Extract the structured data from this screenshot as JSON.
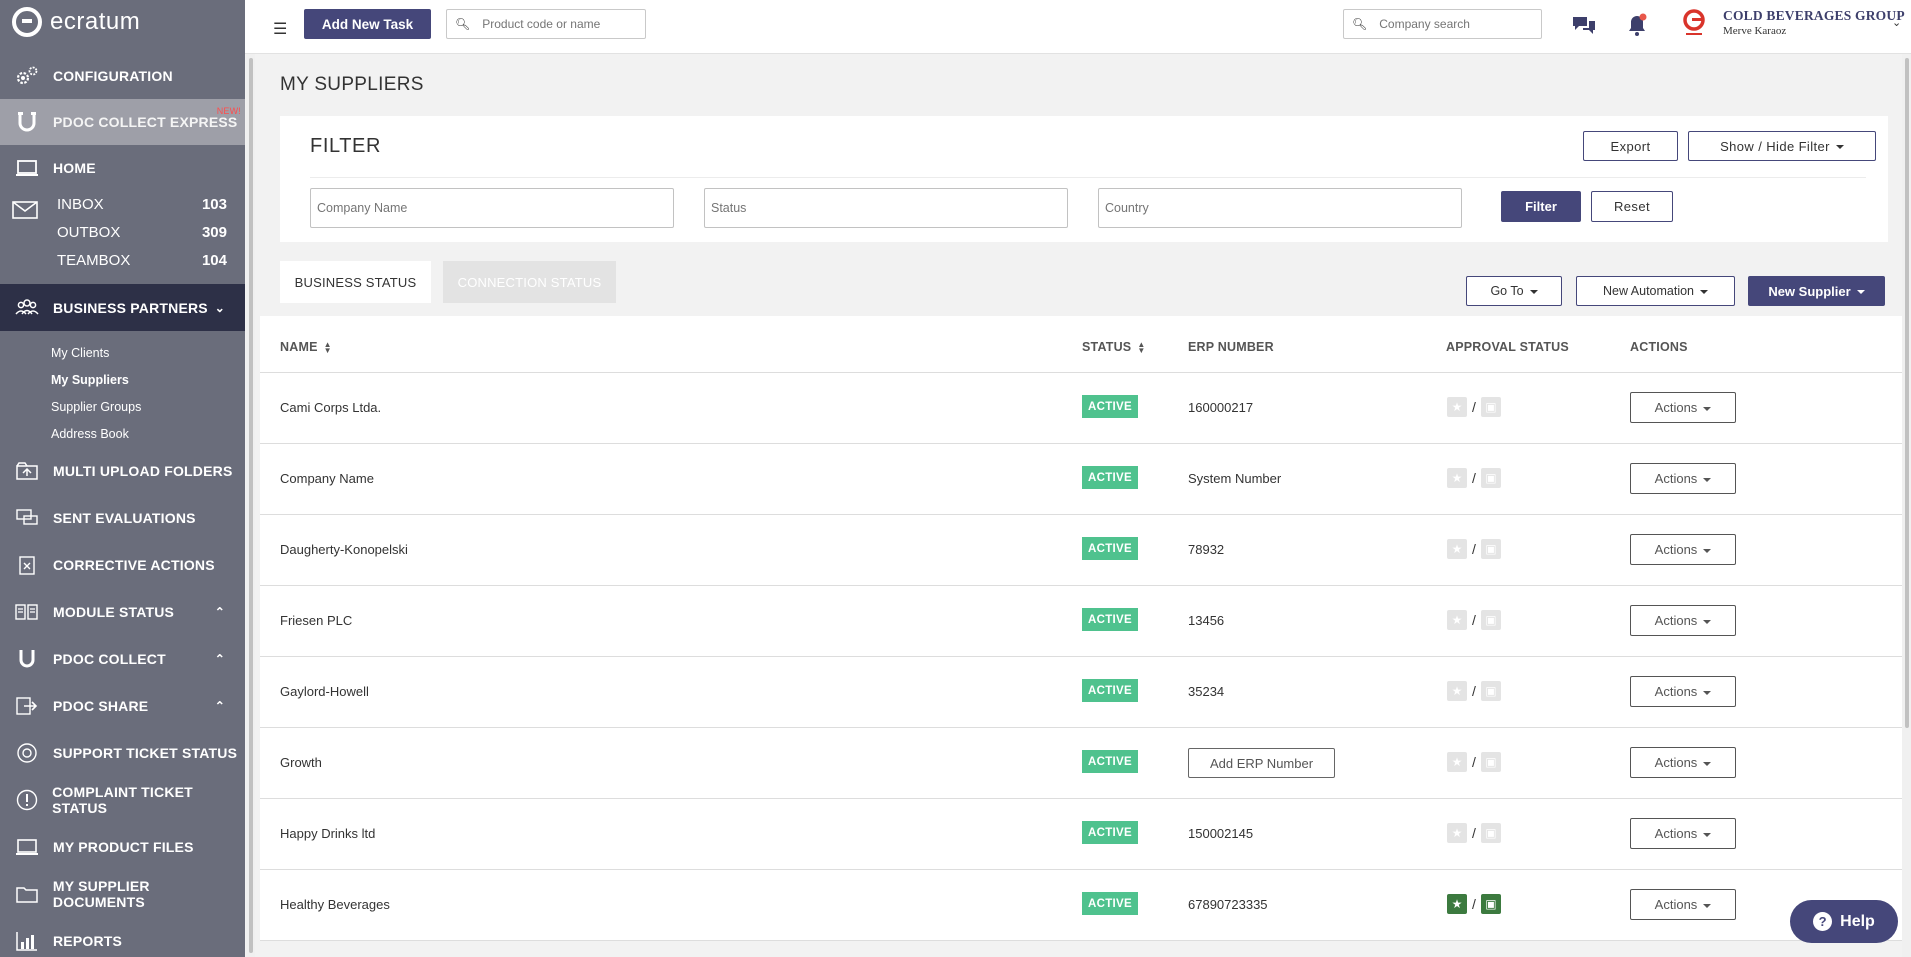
{
  "sidebar": {
    "logo_text": "ecratum",
    "items": [
      {
        "label": "CONFIGURATION",
        "icon": "gears-icon"
      },
      {
        "label": "PDOC COLLECT EXPRESS",
        "icon": "magnet-icon",
        "badge": "NEW!"
      },
      {
        "label": "HOME",
        "icon": "laptop-icon"
      },
      {
        "label": "BUSINESS PARTNERS",
        "icon": "people-icon"
      },
      {
        "label": "MULTI UPLOAD FOLDERS",
        "icon": "folders-icon"
      },
      {
        "label": "SENT EVALUATIONS",
        "icon": "comments-icon"
      },
      {
        "label": "CORRECTIVE ACTIONS",
        "icon": "clipboard-icon"
      },
      {
        "label": "MODULE STATUS",
        "icon": "modules-icon"
      },
      {
        "label": "PDOC COLLECT",
        "icon": "magnet-icon"
      },
      {
        "label": "PDOC SHARE",
        "icon": "share-icon"
      },
      {
        "label": "SUPPORT TICKET STATUS",
        "icon": "lifebuoy-icon"
      },
      {
        "label": "COMPLAINT TICKET STATUS",
        "icon": "exclamation-icon"
      },
      {
        "label": "MY PRODUCT FILES",
        "icon": "laptop-icon"
      },
      {
        "label": "MY SUPPLIER DOCUMENTS",
        "icon": "folder-icon"
      },
      {
        "label": "REPORTS",
        "icon": "bar-chart-icon"
      }
    ],
    "boxes": [
      {
        "label": "INBOX",
        "count": "103"
      },
      {
        "label": "OUTBOX",
        "count": "309"
      },
      {
        "label": "TEAMBOX",
        "count": "104"
      }
    ],
    "partners_sub": [
      "My Clients",
      "My Suppliers",
      "Supplier Groups",
      "Address Book"
    ]
  },
  "topbar": {
    "add_task_label": "Add New Task",
    "product_search_placeholder": "Product code or name",
    "company_search_placeholder": "Company search",
    "company_name": "COLD BEVERAGES GROUP",
    "user_name": "Merve Karaoz"
  },
  "page": {
    "title": "MY SUPPLIERS"
  },
  "filter": {
    "title": "FILTER",
    "export_label": "Export",
    "show_hide_label": "Show / Hide Filter",
    "company_placeholder": "Company Name",
    "status_placeholder": "Status",
    "country_placeholder": "Country",
    "filter_label": "Filter",
    "reset_label": "Reset"
  },
  "tabs": {
    "business": "BUSINESS STATUS",
    "connection": "CONNECTION STATUS"
  },
  "actions_bar": {
    "goto_label": "Go To",
    "automation_label": "New Automation",
    "new_supplier_label": "New Supplier"
  },
  "table": {
    "headers": {
      "name": "NAME",
      "status": "STATUS",
      "erp": "ERP NUMBER",
      "approval": "APPROVAL STATUS",
      "actions": "ACTIONS"
    },
    "add_erp_label": "Add ERP Number",
    "actions_label": "Actions",
    "rows": [
      {
        "name": "Cami Corps Ltda.",
        "status": "ACTIVE",
        "erp": "160000217",
        "approved": false
      },
      {
        "name": "Company Name",
        "status": "ACTIVE",
        "erp": "System Number",
        "approved": false
      },
      {
        "name": "Daugherty-Konopelski",
        "status": "ACTIVE",
        "erp": "78932",
        "approved": false
      },
      {
        "name": "Friesen PLC",
        "status": "ACTIVE",
        "erp": "13456",
        "approved": false
      },
      {
        "name": "Gaylord-Howell",
        "status": "ACTIVE",
        "erp": "35234",
        "approved": false
      },
      {
        "name": "Growth",
        "status": "ACTIVE",
        "erp": "",
        "approved": false
      },
      {
        "name": "Happy Drinks ltd",
        "status": "ACTIVE",
        "erp": "150002145",
        "approved": false
      },
      {
        "name": "Healthy Beverages",
        "status": "ACTIVE",
        "erp": "67890723335",
        "approved": true
      }
    ]
  },
  "help": {
    "label": "Help"
  },
  "colors": {
    "brand": "#45477a",
    "sidebar": "#6a6d7b",
    "active_nav": "#2d3047",
    "status_active": "#4fc28e",
    "approved_green": "#3c7a3f"
  }
}
